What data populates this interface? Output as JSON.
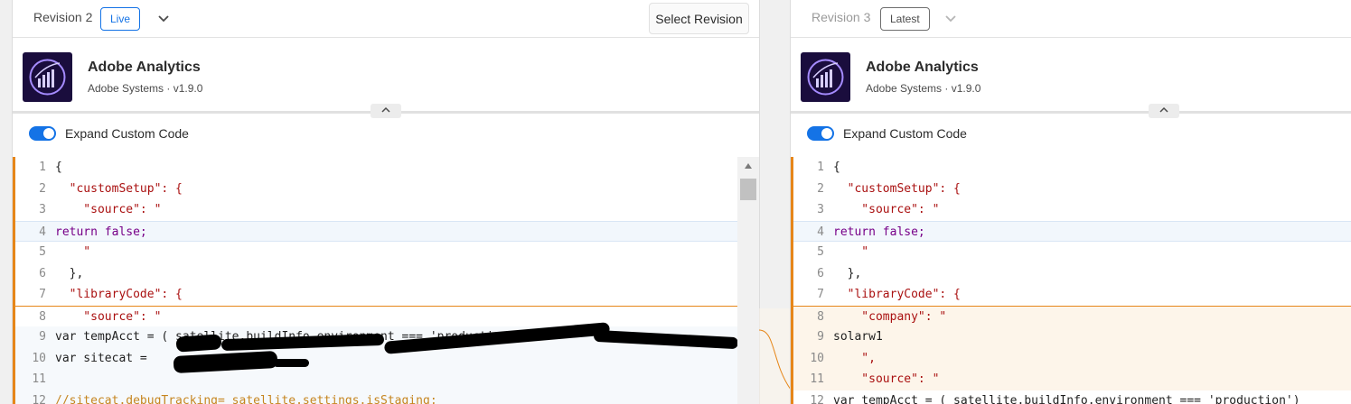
{
  "left": {
    "revision_label": "Revision 2",
    "badge": "Live",
    "select_button": "Select Revision",
    "extension": {
      "name": "Adobe Analytics",
      "meta": "Adobe Systems · v1.9.0"
    },
    "toggle_label": "Expand Custom Code",
    "code_lines": [
      {
        "n": "1",
        "code": "{"
      },
      {
        "n": "2",
        "code": "  \"customSetup\": {"
      },
      {
        "n": "3",
        "code": "    \"source\": \""
      },
      {
        "n": "4",
        "code": "return false;"
      },
      {
        "n": "5",
        "code": "    \""
      },
      {
        "n": "6",
        "code": "  },"
      },
      {
        "n": "7",
        "code": "  \"libraryCode\": {"
      },
      {
        "n": "8",
        "code": "    \"source\": \""
      },
      {
        "n": "9",
        "code": "var tempAcct = ( satellite.buildInfo.environment === 'production') ? '"
      },
      {
        "n": "10",
        "code": "var sitecat ="
      },
      {
        "n": "11",
        "code": ""
      },
      {
        "n": "12",
        "code": "//sitecat.debugTracking= satellite.settings.isStaging;"
      }
    ]
  },
  "right": {
    "revision_label": "Revision 3",
    "badge": "Latest",
    "extension": {
      "name": "Adobe Analytics",
      "meta": "Adobe Systems · v1.9.0"
    },
    "toggle_label": "Expand Custom Code",
    "code_lines": [
      {
        "n": "1",
        "code": "{"
      },
      {
        "n": "2",
        "code": "  \"customSetup\": {"
      },
      {
        "n": "3",
        "code": "    \"source\": \""
      },
      {
        "n": "4",
        "code": "return false;"
      },
      {
        "n": "5",
        "code": "    \""
      },
      {
        "n": "6",
        "code": "  },"
      },
      {
        "n": "7",
        "code": "  \"libraryCode\": {"
      },
      {
        "n": "8",
        "code": "    \"company\": \""
      },
      {
        "n": "9",
        "code": "solarw1"
      },
      {
        "n": "10",
        "code": "    \","
      },
      {
        "n": "11",
        "code": "    \"source\": \""
      },
      {
        "n": "12",
        "code": "var tempAcct = ( satellite.buildInfo.environment === 'production')"
      }
    ]
  },
  "colors": {
    "accent": "#1473e6",
    "diff_orange": "#e68619",
    "logo_bg": "#1a0d3d"
  },
  "icons": [
    "chevron-down-icon",
    "chevron-up-icon",
    "adobe-analytics-logo-icon",
    "scroll-up-arrow-icon"
  ]
}
